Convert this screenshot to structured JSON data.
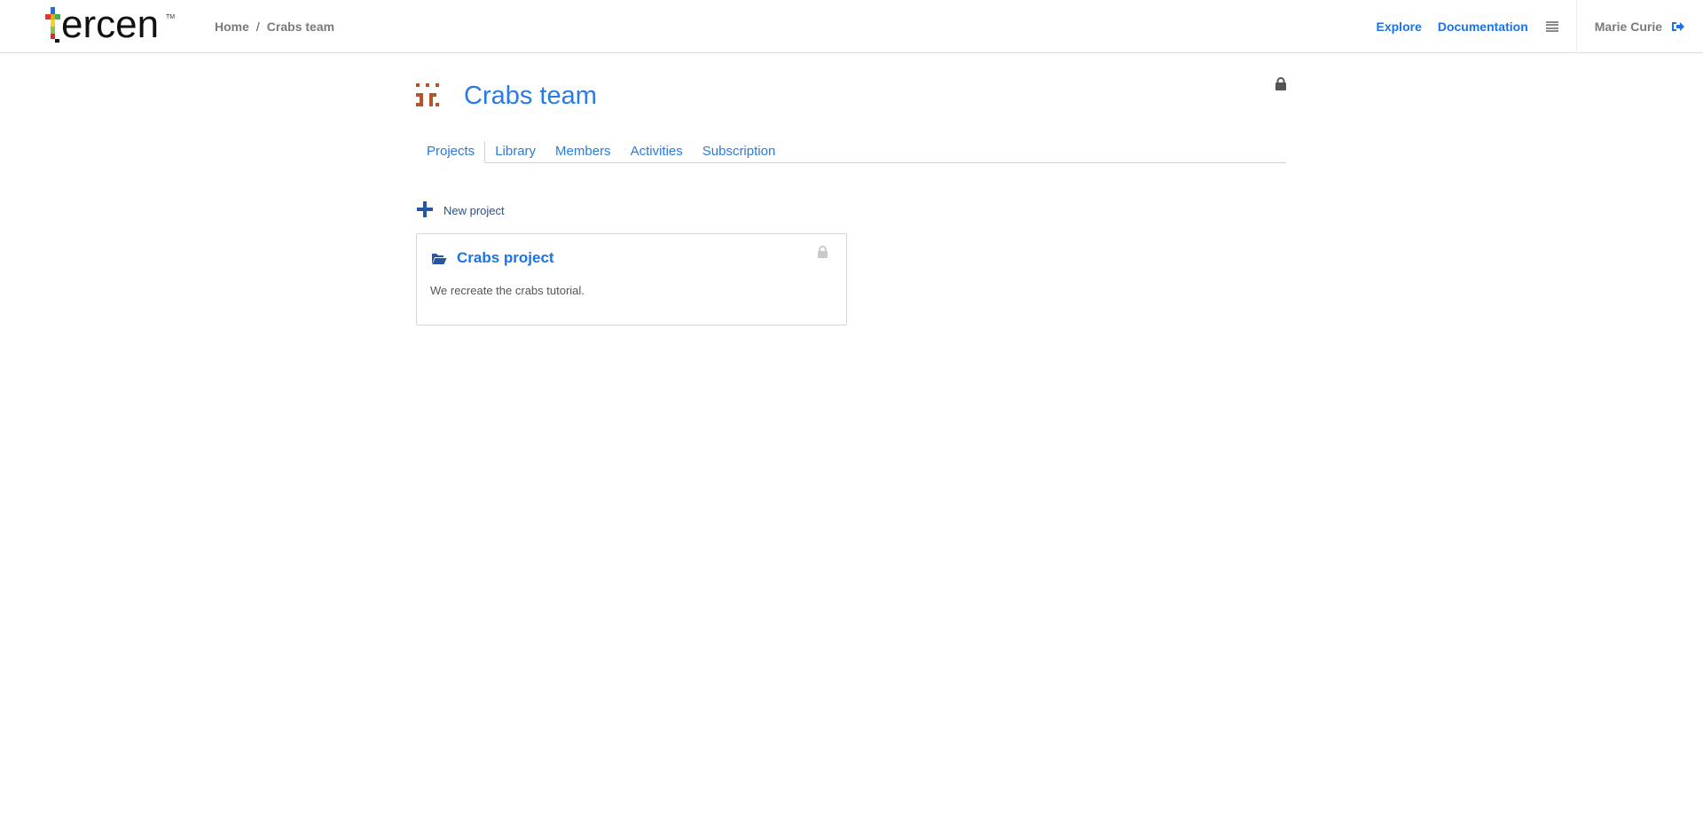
{
  "brand": {
    "logo_text": "ercen",
    "tm": "TM"
  },
  "breadcrumb": {
    "items": [
      "Home",
      "Crabs team"
    ],
    "separator": "/"
  },
  "topnav": {
    "explore": "Explore",
    "documentation": "Documentation",
    "menu_icon": "hamburger-icon",
    "user": "Marie Curie",
    "logout_icon": "sign-out-icon"
  },
  "team": {
    "title": "Crabs team",
    "icon": "team-avatar-icon",
    "lock_icon": "lock-icon"
  },
  "tabs": [
    {
      "label": "Projects",
      "active": true
    },
    {
      "label": "Library",
      "active": false
    },
    {
      "label": "Members",
      "active": false
    },
    {
      "label": "Activities",
      "active": false
    },
    {
      "label": "Subscription",
      "active": false
    }
  ],
  "new_project": {
    "label": "New project",
    "icon": "plus-icon"
  },
  "projects": [
    {
      "title": "Crabs project",
      "description": "We recreate the crabs tutorial.",
      "icon": "folder-open-icon",
      "lock_icon": "lock-icon"
    }
  ],
  "colors": {
    "link_blue": "#1a73e8",
    "title_blue": "#2a7ae2",
    "dark_blue": "#2456a4",
    "team_icon": "#b5542a",
    "muted_gray": "#7a7a7a"
  }
}
